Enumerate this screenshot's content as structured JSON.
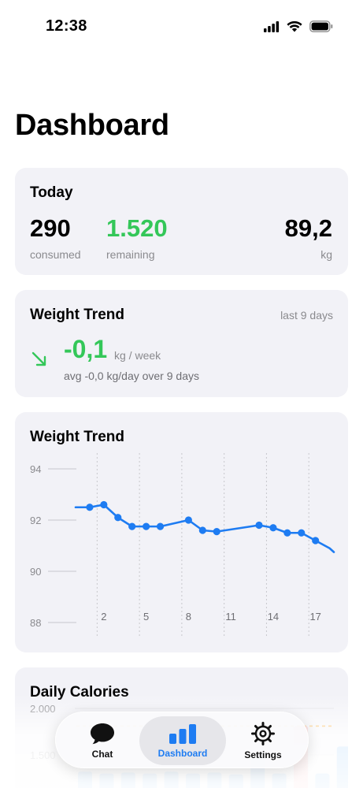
{
  "status_bar": {
    "time": "12:38"
  },
  "page": {
    "title": "Dashboard"
  },
  "today": {
    "title": "Today",
    "consumed_value": "290",
    "consumed_label": "consumed",
    "remaining_value": "1.520",
    "remaining_label": "remaining",
    "weight_value": "89,2",
    "weight_unit": "kg"
  },
  "weight_trend_summary": {
    "title": "Weight Trend",
    "period": "last 9 days",
    "rate_value": "-0,1",
    "rate_unit": "kg / week",
    "average_text": "avg -0,0 kg/day over 9 days"
  },
  "weight_chart": {
    "title": "Weight Trend"
  },
  "daily_calories": {
    "title": "Daily Calories",
    "y_labels": [
      "2.000",
      "1.500"
    ]
  },
  "tab_bar": {
    "items": [
      {
        "label": "Chat",
        "icon": "chat-bubble-icon"
      },
      {
        "label": "Dashboard",
        "icon": "bar-chart-icon",
        "selected": true
      },
      {
        "label": "Settings",
        "icon": "gear-icon"
      }
    ]
  },
  "colors": {
    "accent_green": "#34c759",
    "accent_blue": "#1e7cf2",
    "card_bg": "#f2f2f7",
    "goal_line": "#f5a623"
  },
  "chart_data": [
    {
      "type": "line",
      "title": "Weight Trend",
      "y_ticks": [
        88,
        90,
        92,
        94
      ],
      "ylim": [
        88,
        94
      ],
      "x_ticks": [
        2,
        5,
        8,
        11,
        14,
        17
      ],
      "xlim": [
        0,
        18.3
      ],
      "grid": true,
      "series": [
        {
          "x": [
            0,
            1,
            2,
            3,
            4,
            5,
            6,
            8,
            9,
            10,
            13,
            14,
            15,
            16,
            17,
            18,
            18.3
          ],
          "y": [
            92.5,
            92.5,
            92.6,
            92.1,
            91.75,
            91.75,
            91.75,
            92.0,
            91.6,
            91.55,
            91.8,
            91.7,
            91.5,
            91.5,
            91.2,
            90.9,
            90.75
          ],
          "markers": [
            1,
            2,
            3,
            4,
            5,
            6,
            8,
            9,
            10,
            13,
            14,
            15,
            16,
            17
          ]
        }
      ]
    },
    {
      "type": "bar",
      "title": "Daily Calories",
      "y_ticks": [
        1500,
        2000
      ],
      "goal": 1810,
      "values": [
        1320,
        1300,
        1310,
        1300,
        1320,
        1300,
        1310,
        1290,
        1480,
        1300,
        1810,
        1300,
        1590
      ]
    }
  ]
}
